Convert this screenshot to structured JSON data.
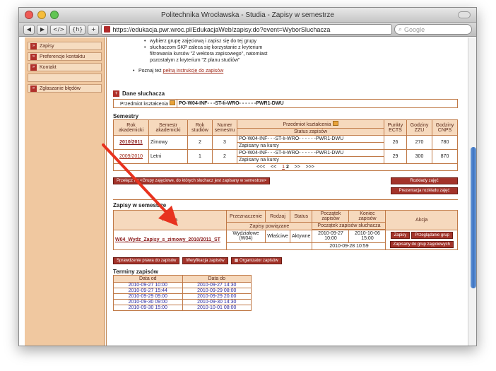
{
  "window": {
    "title": "Politechnika Wrocławska - Studia - Zapisy w semestrze"
  },
  "toolbar": {
    "back": "◀",
    "fwd": "▶",
    "b1": "</>",
    "b2": "{h}",
    "add": "+",
    "url": "https://edukacja.pwr.wroc.pl/EdukacjaWeb/zapisy.do?event=WyborSluchacza",
    "search_placeholder": "Google"
  },
  "sidebar": {
    "items": [
      {
        "label": "Zapisy"
      },
      {
        "label": "Preferencje kontaktu"
      },
      {
        "label": "Kontakt"
      },
      {
        "label": "Zgłaszanie błędów"
      }
    ]
  },
  "intro": {
    "b1": "wybierz grupę zajęciową i zapisz się do tej grupy",
    "b2": "słuchaczom SKP zaleca się korzystanie z kryterium",
    "b2b": "filtrowania kursów \"Z wektora zapisowego\", natomiast",
    "b2c": "pozostałym z kryterium \"Z planu studiów\"",
    "b3_prefix": "Poznaj też ",
    "b3_link": "pełną instrukcję do zapisów"
  },
  "student": {
    "title": "Dane słuchacza",
    "label": "Przedmiot kształcenia",
    "value": "PO-W04-INF- - -ST-Ii-WRO- - - - - -PWR1-DWU"
  },
  "semestry": {
    "title": "Semestry",
    "headers": {
      "rok": "Rok akademicki",
      "sem": "Semestr akademicki",
      "rokst": "Rok studiów",
      "nr": "Numer semestru",
      "przed": "Przedmiot kształcenia",
      "status": "Status zapisów",
      "ects": "Punkty ECTS",
      "zzu": "Godziny ZZU",
      "cnps": "Godziny CNPS"
    },
    "rows": [
      {
        "rok": "2010/2011",
        "sem": "Zimowy",
        "rokst": "2",
        "nr": "3",
        "przed": "PO-W04-INF- - -ST-Ii-WRO- - - - - -PWR1-DWU",
        "status": "Zapisany na kursy",
        "ects": "26",
        "zzu": "270",
        "cnps": "780"
      },
      {
        "rok": "2009/2010",
        "sem": "Letni",
        "rokst": "1",
        "nr": "2",
        "przed": "PO-W04-INF- - -ST-Ii-WRO- - - - - -PWR1-DWU",
        "status": "Zapisany na kursy",
        "ects": "29",
        "zzu": "300",
        "cnps": "870"
      }
    ],
    "pager": {
      "first": "<<<",
      "prev": "<<",
      "p1": "1",
      "p2": "2",
      "next": ">>",
      "last": ">>>"
    },
    "btn_switch": "Przełącz na <Grupy zajęciowe, do których słuchacz jest zapisany w semestrze>",
    "btn_plan": "Rozkłady zajęć",
    "btn_present": "Prezentacja rozkładu zajęć"
  },
  "zapisy": {
    "title": "Zapisy w semestrze",
    "headers": {
      "nazwa": "Nazwa",
      "przezn": "Przeznaczenie",
      "rodzaj": "Rodzaj",
      "status": "Status",
      "poczatek": "Początek zapisów",
      "koniec": "Koniec zapisów",
      "powiazane": "Zapisy powiązane",
      "poczatek_sl": "Początek zapisów słuchacza",
      "akcja": "Akcja"
    },
    "row": {
      "nazwa": "W04_Wydz_Zapisy_s_zimowy_2010/2011_ST",
      "przezn": "Wydziałowe (W04)",
      "rodzaj": "Właściwe",
      "status": "Aktywne",
      "poczatek": "2010-09-27 10:00",
      "koniec": "2010-10-06 15:00",
      "poczatek_sl": "2010-09-28 10:59",
      "btn_zapisy": "Zapisy",
      "btn_przeglad": "Przeglądanie grup",
      "btn_zapisany": "Zapisany do grup zajęciowych"
    },
    "btn_spr": "Sprawdzenie prawa do zapisów",
    "btn_wer": "Weryfikacja zapisów",
    "btn_org": "Organizator zapisów"
  },
  "terminy": {
    "title": "Terminy zapisów",
    "headers": {
      "od": "Data od",
      "do": "Data do"
    },
    "rows": [
      {
        "od": "2010-09-27 10:00",
        "do": "2010-09-27 14:30"
      },
      {
        "od": "2010-09-27 15:44",
        "do": "2010-09-29 08:00"
      },
      {
        "od": "2010-09-29 09:00",
        "do": "2010-09-29 20:00"
      },
      {
        "od": "2010-09-30 09:00",
        "do": "2010-09-30 14:30"
      },
      {
        "od": "2010-09-30 15:00",
        "do": "2010-10-01 08:00"
      }
    ]
  }
}
